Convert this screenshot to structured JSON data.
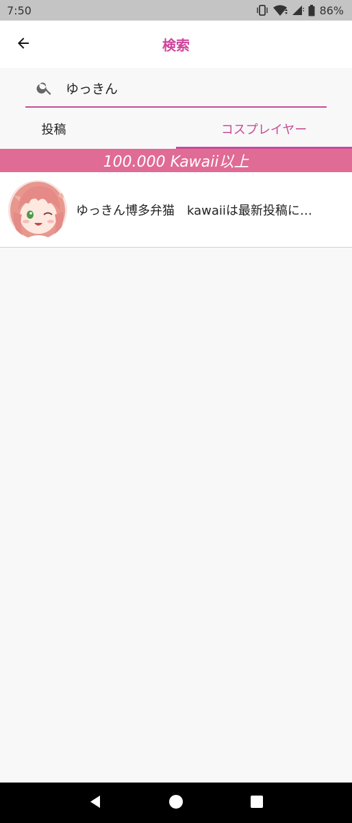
{
  "status_bar": {
    "time": "7:50",
    "battery": "86%",
    "icons": [
      "vibrate-icon",
      "wifi-icon",
      "signal-icon",
      "battery-icon"
    ]
  },
  "app_bar": {
    "title": "検索",
    "back_icon": "arrow-left-icon"
  },
  "search": {
    "value": "ゆっきん",
    "icon": "search-icon"
  },
  "tabs": [
    {
      "label": "投稿",
      "active": false
    },
    {
      "label": "コスプレイヤー",
      "active": true
    }
  ],
  "banner": {
    "text": "100.000 Kawaii以上"
  },
  "results": [
    {
      "name": "ゆっきん博多弁猫　kawaiiは最新投稿に…"
    }
  ],
  "colors": {
    "accent": "#c84a98",
    "banner": "#e06b94",
    "status_bar": "#c4c4c4",
    "background": "#f8f8f8"
  },
  "nav_bar": {
    "icons": [
      "back-triangle-icon",
      "home-circle-icon",
      "recents-square-icon"
    ]
  }
}
